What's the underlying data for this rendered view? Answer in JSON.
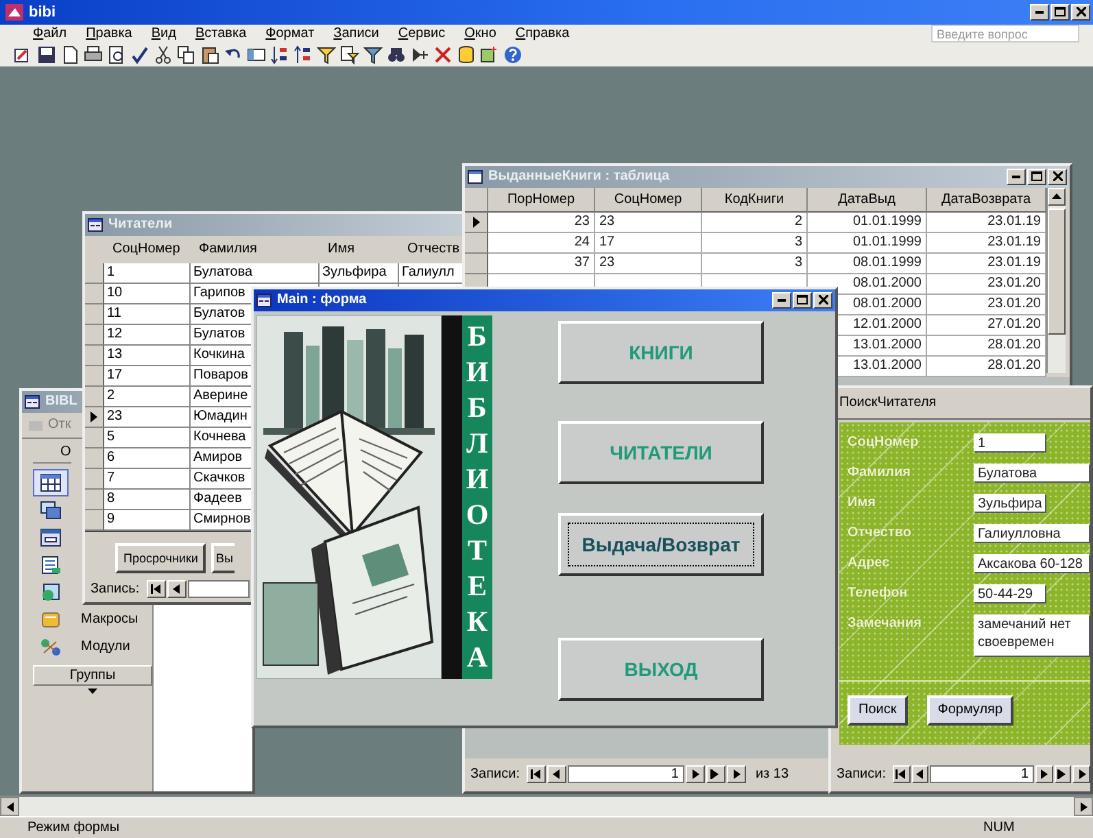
{
  "app": {
    "title": "bibi",
    "help_placeholder": "Введите вопрос"
  },
  "menu": [
    "Файл",
    "Правка",
    "Вид",
    "Вставка",
    "Формат",
    "Записи",
    "Сервис",
    "Окно",
    "Справка"
  ],
  "database_window": {
    "title": "BIBL",
    "open_label": "Отк",
    "header": "О",
    "groups_label": "Группы",
    "objects": [
      {
        "kind": "table",
        "selected": true
      },
      {
        "kind": "query",
        "selected": false
      },
      {
        "kind": "form",
        "selected": false
      },
      {
        "kind": "report",
        "selected": false
      },
      {
        "kind": "page",
        "selected": false
      },
      {
        "kind": "macro",
        "label": "Макросы",
        "selected": false
      },
      {
        "kind": "module",
        "label": "Модули",
        "selected": false
      }
    ]
  },
  "readers_form": {
    "title": "Читатели",
    "columns": [
      "СоцНомер",
      "Фамилия",
      "Имя",
      "Отчеств"
    ],
    "rows": [
      {
        "cells": [
          "1",
          "Булатова",
          "Зульфира",
          "Галиулл"
        ],
        "selected": false
      },
      {
        "cells": [
          "10",
          "Гарипов"
        ],
        "selected": false
      },
      {
        "cells": [
          "11",
          "Булатов"
        ],
        "selected": false
      },
      {
        "cells": [
          "12",
          "Булатов"
        ],
        "selected": false
      },
      {
        "cells": [
          "13",
          "Кочкина"
        ],
        "selected": false
      },
      {
        "cells": [
          "17",
          "Поваров"
        ],
        "selected": false
      },
      {
        "cells": [
          "2",
          "Аверине"
        ],
        "selected": false
      },
      {
        "cells": [
          "23",
          "Юмадин"
        ],
        "selected": true
      },
      {
        "cells": [
          "5",
          "Кочнева"
        ],
        "selected": false
      },
      {
        "cells": [
          "6",
          "Амиров"
        ],
        "selected": false
      },
      {
        "cells": [
          "7",
          "Скачков"
        ],
        "selected": false
      },
      {
        "cells": [
          "8",
          "Фадеев"
        ],
        "selected": false
      },
      {
        "cells": [
          "9",
          "Смирнов"
        ],
        "selected": false
      }
    ],
    "buttons": [
      "Просрочники",
      "Вы"
    ],
    "nav_label": "Запись:"
  },
  "books_table": {
    "title": "ВыданныеКниги : таблица",
    "columns": [
      "ПорНомер",
      "СоцНомер",
      "КодКниги",
      "ДатаВыд",
      "ДатаВозврата"
    ],
    "rows": [
      {
        "por": "23",
        "soc": "23",
        "kod": "2",
        "issued": "01.01.1999",
        "returned": "23.01.19",
        "selected": true
      },
      {
        "por": "24",
        "soc": "17",
        "kod": "3",
        "issued": "01.01.1999",
        "returned": "23.01.19",
        "selected": false
      },
      {
        "por": "37",
        "soc": "23",
        "kod": "3",
        "issued": "08.01.1999",
        "returned": "23.01.19",
        "selected": false
      },
      {
        "issued": "08.01.2000",
        "returned": "23.01.20"
      },
      {
        "issued": "08.01.2000",
        "returned": "23.01.20"
      },
      {
        "issued": "12.01.2000",
        "returned": "27.01.20"
      },
      {
        "issued": "13.01.2000",
        "returned": "28.01.20"
      },
      {
        "issued": "13.01.2000",
        "returned": "28.01.20"
      }
    ],
    "nav_label": "Записи:",
    "nav_value": "1",
    "nav_total": "из 13"
  },
  "search_form": {
    "title": "ПоискЧитателя",
    "fields": [
      {
        "label": "СоцНомер",
        "value": "1",
        "kind": "short"
      },
      {
        "label": "Фамилия",
        "value": "Булатова",
        "kind": "long"
      },
      {
        "label": "Имя",
        "value": "Зульфира",
        "kind": "short"
      },
      {
        "label": "Отчество",
        "value": "Галиулловна",
        "kind": "long"
      },
      {
        "label": "Адрес",
        "value": "Аксакова 60-128",
        "kind": "long"
      },
      {
        "label": "Телефон",
        "value": "50-44-29",
        "kind": "short"
      },
      {
        "label": "Замечания",
        "value": "замечаний нет своевремен",
        "kind": "memo"
      }
    ],
    "buttons": [
      "Поиск",
      "Формуляр"
    ],
    "nav_label": "Записи:",
    "nav_value": "1"
  },
  "main_form": {
    "title": "Main : форма",
    "banner": "БИБЛИОТЕКА",
    "buttons": [
      {
        "label": "КНИГИ",
        "focused": false
      },
      {
        "label": "ЧИТАТЕЛИ",
        "focused": false
      },
      {
        "label": "Выдача/Возврат",
        "focused": true
      },
      {
        "label": "ВЫХОД",
        "focused": false
      }
    ]
  },
  "status_bar": {
    "mode": "Режим формы",
    "indicator": "NUM"
  }
}
